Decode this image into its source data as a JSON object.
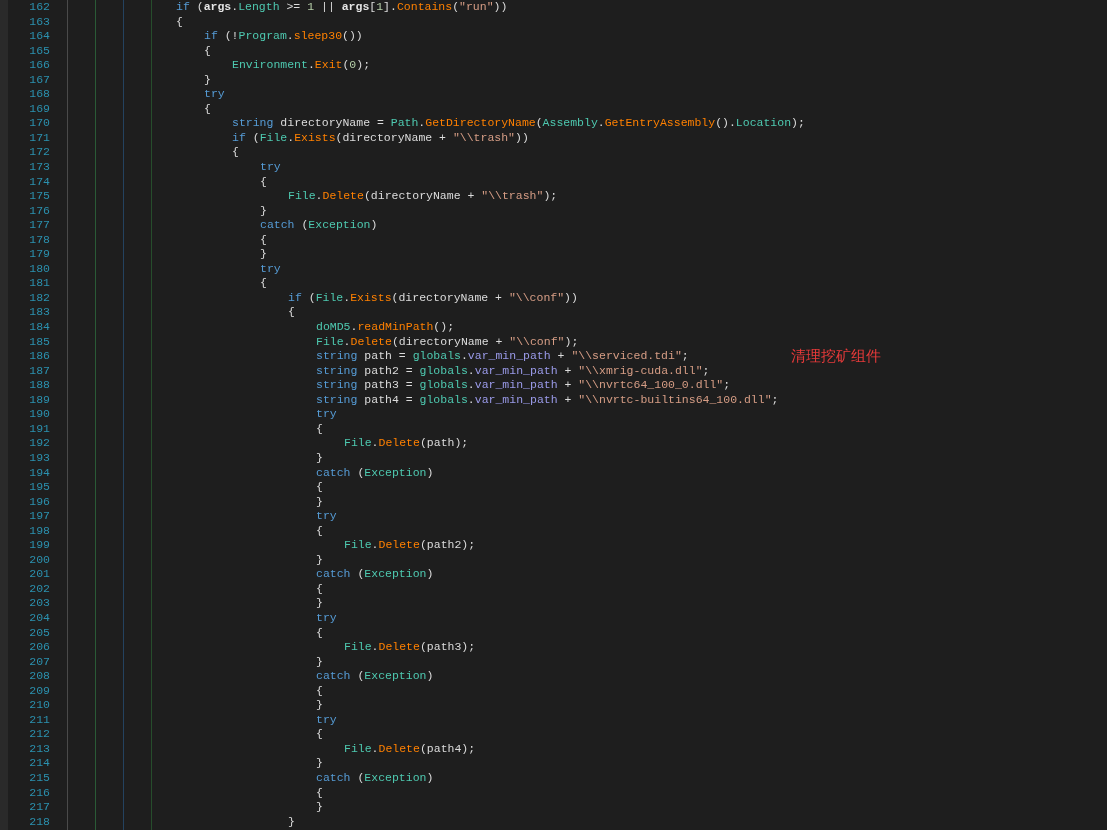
{
  "editor": {
    "lines": [
      {
        "number": "162",
        "tokens": [
          {
            "kind": "k",
            "text": "if"
          },
          {
            "kind": "p",
            "text": " ("
          },
          {
            "kind": "b",
            "text": "args"
          },
          {
            "kind": "p",
            "text": "."
          },
          {
            "kind": "f",
            "text": "Length"
          },
          {
            "kind": "p",
            "text": " >= "
          },
          {
            "kind": "n",
            "text": "1"
          },
          {
            "kind": "p",
            "text": " || "
          },
          {
            "kind": "b",
            "text": "args"
          },
          {
            "kind": "p",
            "text": "["
          },
          {
            "kind": "n",
            "text": "1"
          },
          {
            "kind": "p",
            "text": "]."
          },
          {
            "kind": "m",
            "text": "Contains"
          },
          {
            "kind": "p",
            "text": "("
          },
          {
            "kind": "s",
            "text": "\"run\""
          },
          {
            "kind": "p",
            "text": "))"
          }
        ]
      },
      {
        "number": "163",
        "tokens": [
          {
            "kind": "p",
            "text": "{"
          }
        ],
        "children": [
          {
            "number": "164",
            "tokens": [
              {
                "kind": "k",
                "text": "if"
              },
              {
                "kind": "p",
                "text": " (!"
              },
              {
                "kind": "t",
                "text": "Program"
              },
              {
                "kind": "p",
                "text": "."
              },
              {
                "kind": "m",
                "text": "sleep30"
              },
              {
                "kind": "p",
                "text": "())"
              }
            ]
          },
          {
            "number": "165",
            "tokens": [
              {
                "kind": "p",
                "text": "{"
              }
            ],
            "children": [
              {
                "number": "166",
                "tokens": [
                  {
                    "kind": "t",
                    "text": "Environment"
                  },
                  {
                    "kind": "p",
                    "text": "."
                  },
                  {
                    "kind": "m",
                    "text": "Exit"
                  },
                  {
                    "kind": "p",
                    "text": "("
                  },
                  {
                    "kind": "n",
                    "text": "0"
                  },
                  {
                    "kind": "p",
                    "text": ");"
                  }
                ]
              }
            ]
          },
          {
            "number": "167",
            "tokens": [
              {
                "kind": "p",
                "text": "}"
              }
            ]
          },
          {
            "number": "168",
            "tokens": [
              {
                "kind": "k",
                "text": "try"
              }
            ]
          },
          {
            "number": "169",
            "tokens": [
              {
                "kind": "p",
                "text": "{"
              }
            ],
            "children": [
              {
                "number": "170",
                "tokens": [
                  {
                    "kind": "k",
                    "text": "string"
                  },
                  {
                    "kind": "p",
                    "text": " directoryName = "
                  },
                  {
                    "kind": "t",
                    "text": "Path"
                  },
                  {
                    "kind": "p",
                    "text": "."
                  },
                  {
                    "kind": "m",
                    "text": "GetDirectoryName"
                  },
                  {
                    "kind": "p",
                    "text": "("
                  },
                  {
                    "kind": "t",
                    "text": "Assembly"
                  },
                  {
                    "kind": "p",
                    "text": "."
                  },
                  {
                    "kind": "m",
                    "text": "GetEntryAssembly"
                  },
                  {
                    "kind": "p",
                    "text": "()."
                  },
                  {
                    "kind": "f",
                    "text": "Location"
                  },
                  {
                    "kind": "p",
                    "text": ");"
                  }
                ]
              },
              {
                "number": "171",
                "tokens": [
                  {
                    "kind": "k",
                    "text": "if"
                  },
                  {
                    "kind": "p",
                    "text": " ("
                  },
                  {
                    "kind": "t",
                    "text": "File"
                  },
                  {
                    "kind": "p",
                    "text": "."
                  },
                  {
                    "kind": "m",
                    "text": "Exists"
                  },
                  {
                    "kind": "p",
                    "text": "(directoryName + "
                  },
                  {
                    "kind": "s",
                    "text": "\"\\\\trash\""
                  },
                  {
                    "kind": "p",
                    "text": "))"
                  }
                ]
              },
              {
                "number": "172",
                "tokens": [
                  {
                    "kind": "p",
                    "text": "{"
                  }
                ],
                "children": [
                  {
                    "number": "173",
                    "tokens": [
                      {
                        "kind": "k",
                        "text": "try"
                      }
                    ]
                  },
                  {
                    "number": "174",
                    "tokens": [
                      {
                        "kind": "p",
                        "text": "{"
                      }
                    ],
                    "children": [
                      {
                        "number": "175",
                        "tokens": [
                          {
                            "kind": "t",
                            "text": "File"
                          },
                          {
                            "kind": "p",
                            "text": "."
                          },
                          {
                            "kind": "m",
                            "text": "Delete"
                          },
                          {
                            "kind": "p",
                            "text": "(directoryName + "
                          },
                          {
                            "kind": "s",
                            "text": "\"\\\\trash\""
                          },
                          {
                            "kind": "p",
                            "text": ");"
                          }
                        ]
                      }
                    ]
                  },
                  {
                    "number": "176",
                    "tokens": [
                      {
                        "kind": "p",
                        "text": "}"
                      }
                    ]
                  },
                  {
                    "number": "177",
                    "tokens": [
                      {
                        "kind": "k",
                        "text": "catch"
                      },
                      {
                        "kind": "p",
                        "text": " ("
                      },
                      {
                        "kind": "t",
                        "text": "Exception"
                      },
                      {
                        "kind": "p",
                        "text": ")"
                      }
                    ]
                  },
                  {
                    "number": "178",
                    "tokens": [
                      {
                        "kind": "p",
                        "text": "{"
                      }
                    ]
                  },
                  {
                    "number": "179",
                    "tokens": [
                      {
                        "kind": "p",
                        "text": "}"
                      }
                    ]
                  },
                  {
                    "number": "180",
                    "tokens": [
                      {
                        "kind": "k",
                        "text": "try"
                      }
                    ]
                  },
                  {
                    "number": "181",
                    "tokens": [
                      {
                        "kind": "p",
                        "text": "{"
                      }
                    ],
                    "children": [
                      {
                        "number": "182",
                        "tokens": [
                          {
                            "kind": "k",
                            "text": "if"
                          },
                          {
                            "kind": "p",
                            "text": " ("
                          },
                          {
                            "kind": "t",
                            "text": "File"
                          },
                          {
                            "kind": "p",
                            "text": "."
                          },
                          {
                            "kind": "m",
                            "text": "Exists"
                          },
                          {
                            "kind": "p",
                            "text": "(directoryName + "
                          },
                          {
                            "kind": "s",
                            "text": "\"\\\\conf\""
                          },
                          {
                            "kind": "p",
                            "text": "))"
                          }
                        ]
                      },
                      {
                        "number": "183",
                        "tokens": [
                          {
                            "kind": "p",
                            "text": "{"
                          }
                        ],
                        "children": [
                          {
                            "number": "184",
                            "tokens": [
                              {
                                "kind": "t",
                                "text": "doMD5"
                              },
                              {
                                "kind": "p",
                                "text": "."
                              },
                              {
                                "kind": "m",
                                "text": "readMinPath"
                              },
                              {
                                "kind": "p",
                                "text": "();"
                              }
                            ]
                          },
                          {
                            "number": "185",
                            "tokens": [
                              {
                                "kind": "t",
                                "text": "File"
                              },
                              {
                                "kind": "p",
                                "text": "."
                              },
                              {
                                "kind": "m",
                                "text": "Delete"
                              },
                              {
                                "kind": "p",
                                "text": "(directoryName + "
                              },
                              {
                                "kind": "s",
                                "text": "\"\\\\conf\""
                              },
                              {
                                "kind": "p",
                                "text": ");"
                              }
                            ]
                          },
                          {
                            "number": "186",
                            "tokens": [
                              {
                                "kind": "k",
                                "text": "string"
                              },
                              {
                                "kind": "p",
                                "text": " path = "
                              },
                              {
                                "kind": "t",
                                "text": "globals"
                              },
                              {
                                "kind": "p",
                                "text": "."
                              },
                              {
                                "kind": "v",
                                "text": "var_min_path"
                              },
                              {
                                "kind": "p",
                                "text": " + "
                              },
                              {
                                "kind": "s",
                                "text": "\"\\\\serviced.tdi\""
                              },
                              {
                                "kind": "p",
                                "text": ";"
                              }
                            ],
                            "note": "清理挖矿组件"
                          },
                          {
                            "number": "187",
                            "tokens": [
                              {
                                "kind": "k",
                                "text": "string"
                              },
                              {
                                "kind": "p",
                                "text": " path2 = "
                              },
                              {
                                "kind": "t",
                                "text": "globals"
                              },
                              {
                                "kind": "p",
                                "text": "."
                              },
                              {
                                "kind": "v",
                                "text": "var_min_path"
                              },
                              {
                                "kind": "p",
                                "text": " + "
                              },
                              {
                                "kind": "s",
                                "text": "\"\\\\xmrig-cuda.dll\""
                              },
                              {
                                "kind": "p",
                                "text": ";"
                              }
                            ]
                          },
                          {
                            "number": "188",
                            "tokens": [
                              {
                                "kind": "k",
                                "text": "string"
                              },
                              {
                                "kind": "p",
                                "text": " path3 = "
                              },
                              {
                                "kind": "t",
                                "text": "globals"
                              },
                              {
                                "kind": "p",
                                "text": "."
                              },
                              {
                                "kind": "v",
                                "text": "var_min_path"
                              },
                              {
                                "kind": "p",
                                "text": " + "
                              },
                              {
                                "kind": "s",
                                "text": "\"\\\\nvrtc64_100_0.dll\""
                              },
                              {
                                "kind": "p",
                                "text": ";"
                              }
                            ]
                          },
                          {
                            "number": "189",
                            "tokens": [
                              {
                                "kind": "k",
                                "text": "string"
                              },
                              {
                                "kind": "p",
                                "text": " path4 = "
                              },
                              {
                                "kind": "t",
                                "text": "globals"
                              },
                              {
                                "kind": "p",
                                "text": "."
                              },
                              {
                                "kind": "v",
                                "text": "var_min_path"
                              },
                              {
                                "kind": "p",
                                "text": " + "
                              },
                              {
                                "kind": "s",
                                "text": "\"\\\\nvrtc-builtins64_100.dll\""
                              },
                              {
                                "kind": "p",
                                "text": ";"
                              }
                            ]
                          },
                          {
                            "number": "190",
                            "tokens": [
                              {
                                "kind": "k",
                                "text": "try"
                              }
                            ]
                          },
                          {
                            "number": "191",
                            "tokens": [
                              {
                                "kind": "p",
                                "text": "{"
                              }
                            ],
                            "children": [
                              {
                                "number": "192",
                                "tokens": [
                                  {
                                    "kind": "t",
                                    "text": "File"
                                  },
                                  {
                                    "kind": "p",
                                    "text": "."
                                  },
                                  {
                                    "kind": "m",
                                    "text": "Delete"
                                  },
                                  {
                                    "kind": "p",
                                    "text": "(path);"
                                  }
                                ]
                              }
                            ]
                          },
                          {
                            "number": "193",
                            "tokens": [
                              {
                                "kind": "p",
                                "text": "}"
                              }
                            ]
                          },
                          {
                            "number": "194",
                            "tokens": [
                              {
                                "kind": "k",
                                "text": "catch"
                              },
                              {
                                "kind": "p",
                                "text": " ("
                              },
                              {
                                "kind": "t",
                                "text": "Exception"
                              },
                              {
                                "kind": "p",
                                "text": ")"
                              }
                            ]
                          },
                          {
                            "number": "195",
                            "tokens": [
                              {
                                "kind": "p",
                                "text": "{"
                              }
                            ]
                          },
                          {
                            "number": "196",
                            "tokens": [
                              {
                                "kind": "p",
                                "text": "}"
                              }
                            ]
                          },
                          {
                            "number": "197",
                            "tokens": [
                              {
                                "kind": "k",
                                "text": "try"
                              }
                            ]
                          },
                          {
                            "number": "198",
                            "tokens": [
                              {
                                "kind": "p",
                                "text": "{"
                              }
                            ],
                            "children": [
                              {
                                "number": "199",
                                "tokens": [
                                  {
                                    "kind": "t",
                                    "text": "File"
                                  },
                                  {
                                    "kind": "p",
                                    "text": "."
                                  },
                                  {
                                    "kind": "m",
                                    "text": "Delete"
                                  },
                                  {
                                    "kind": "p",
                                    "text": "(path2);"
                                  }
                                ]
                              }
                            ]
                          },
                          {
                            "number": "200",
                            "tokens": [
                              {
                                "kind": "p",
                                "text": "}"
                              }
                            ]
                          },
                          {
                            "number": "201",
                            "tokens": [
                              {
                                "kind": "k",
                                "text": "catch"
                              },
                              {
                                "kind": "p",
                                "text": " ("
                              },
                              {
                                "kind": "t",
                                "text": "Exception"
                              },
                              {
                                "kind": "p",
                                "text": ")"
                              }
                            ]
                          },
                          {
                            "number": "202",
                            "tokens": [
                              {
                                "kind": "p",
                                "text": "{"
                              }
                            ]
                          },
                          {
                            "number": "203",
                            "tokens": [
                              {
                                "kind": "p",
                                "text": "}"
                              }
                            ]
                          },
                          {
                            "number": "204",
                            "tokens": [
                              {
                                "kind": "k",
                                "text": "try"
                              }
                            ]
                          },
                          {
                            "number": "205",
                            "tokens": [
                              {
                                "kind": "p",
                                "text": "{"
                              }
                            ],
                            "children": [
                              {
                                "number": "206",
                                "tokens": [
                                  {
                                    "kind": "t",
                                    "text": "File"
                                  },
                                  {
                                    "kind": "p",
                                    "text": "."
                                  },
                                  {
                                    "kind": "m",
                                    "text": "Delete"
                                  },
                                  {
                                    "kind": "p",
                                    "text": "(path3);"
                                  }
                                ]
                              }
                            ]
                          },
                          {
                            "number": "207",
                            "tokens": [
                              {
                                "kind": "p",
                                "text": "}"
                              }
                            ]
                          },
                          {
                            "number": "208",
                            "tokens": [
                              {
                                "kind": "k",
                                "text": "catch"
                              },
                              {
                                "kind": "p",
                                "text": " ("
                              },
                              {
                                "kind": "t",
                                "text": "Exception"
                              },
                              {
                                "kind": "p",
                                "text": ")"
                              }
                            ]
                          },
                          {
                            "number": "209",
                            "tokens": [
                              {
                                "kind": "p",
                                "text": "{"
                              }
                            ]
                          },
                          {
                            "number": "210",
                            "tokens": [
                              {
                                "kind": "p",
                                "text": "}"
                              }
                            ]
                          },
                          {
                            "number": "211",
                            "tokens": [
                              {
                                "kind": "k",
                                "text": "try"
                              }
                            ]
                          },
                          {
                            "number": "212",
                            "tokens": [
                              {
                                "kind": "p",
                                "text": "{"
                              }
                            ],
                            "children": [
                              {
                                "number": "213",
                                "tokens": [
                                  {
                                    "kind": "t",
                                    "text": "File"
                                  },
                                  {
                                    "kind": "p",
                                    "text": "."
                                  },
                                  {
                                    "kind": "m",
                                    "text": "Delete"
                                  },
                                  {
                                    "kind": "p",
                                    "text": "(path4);"
                                  }
                                ]
                              }
                            ]
                          },
                          {
                            "number": "214",
                            "tokens": [
                              {
                                "kind": "p",
                                "text": "}"
                              }
                            ]
                          },
                          {
                            "number": "215",
                            "tokens": [
                              {
                                "kind": "k",
                                "text": "catch"
                              },
                              {
                                "kind": "p",
                                "text": " ("
                              },
                              {
                                "kind": "t",
                                "text": "Exception"
                              },
                              {
                                "kind": "p",
                                "text": ")"
                              }
                            ]
                          },
                          {
                            "number": "216",
                            "tokens": [
                              {
                                "kind": "p",
                                "text": "{"
                              }
                            ]
                          },
                          {
                            "number": "217",
                            "tokens": [
                              {
                                "kind": "p",
                                "text": "}"
                              }
                            ]
                          }
                        ]
                      },
                      {
                        "number": "218",
                        "tokens": [
                          {
                            "kind": "p",
                            "text": "}"
                          }
                        ]
                      }
                    ]
                  }
                ]
              }
            ]
          }
        ]
      }
    ]
  }
}
